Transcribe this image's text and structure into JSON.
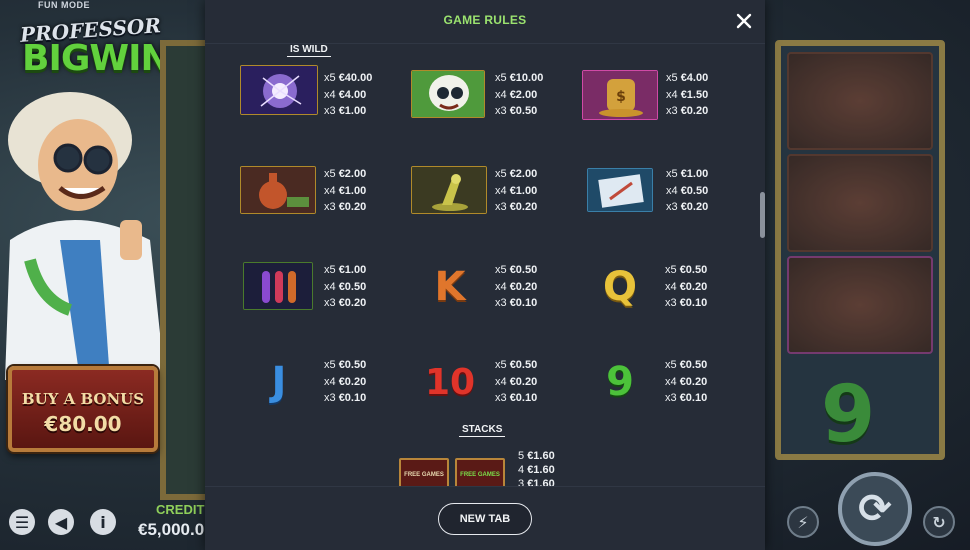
{
  "game": {
    "fun_mode": "FUN MODE",
    "logo_line1": "PROFESSOR",
    "logo_line2": "BIGWIN",
    "buy_bonus_label": "BUY A BONUS",
    "buy_bonus_price": "€80.00",
    "credit_label": "CREDIT",
    "credit_value": "€5,000.0",
    "reel_symbol": "9"
  },
  "modal": {
    "title": "GAME RULES",
    "close_icon": "close-icon",
    "is_wild_heading": "IS WILD",
    "stacks_heading": "STACKS",
    "new_tab_label": "NEW TAB",
    "paytable": [
      {
        "symbol": "plasma-ball",
        "pays": [
          {
            "count": "x5",
            "value": "€40.00"
          },
          {
            "count": "x4",
            "value": "€4.00"
          },
          {
            "count": "x3",
            "value": "€1.00"
          }
        ]
      },
      {
        "symbol": "professor-face",
        "pays": [
          {
            "count": "x5",
            "value": "€10.00"
          },
          {
            "count": "x4",
            "value": "€2.00"
          },
          {
            "count": "x3",
            "value": "€0.50"
          }
        ]
      },
      {
        "symbol": "money-jar",
        "pays": [
          {
            "count": "x5",
            "value": "€4.00"
          },
          {
            "count": "x4",
            "value": "€1.50"
          },
          {
            "count": "x3",
            "value": "€0.20"
          }
        ]
      },
      {
        "symbol": "flask",
        "pays": [
          {
            "count": "x5",
            "value": "€2.00"
          },
          {
            "count": "x4",
            "value": "€1.00"
          },
          {
            "count": "x3",
            "value": "€0.20"
          }
        ]
      },
      {
        "symbol": "microscope",
        "pays": [
          {
            "count": "x5",
            "value": "€2.00"
          },
          {
            "count": "x4",
            "value": "€1.00"
          },
          {
            "count": "x3",
            "value": "€0.20"
          }
        ]
      },
      {
        "symbol": "blueprint",
        "pays": [
          {
            "count": "x5",
            "value": "€1.00"
          },
          {
            "count": "x4",
            "value": "€0.50"
          },
          {
            "count": "x3",
            "value": "€0.20"
          }
        ]
      },
      {
        "symbol": "test-tubes",
        "pays": [
          {
            "count": "x5",
            "value": "€1.00"
          },
          {
            "count": "x4",
            "value": "€0.50"
          },
          {
            "count": "x3",
            "value": "€0.20"
          }
        ]
      },
      {
        "symbol": "K",
        "pays": [
          {
            "count": "x5",
            "value": "€0.50"
          },
          {
            "count": "x4",
            "value": "€0.20"
          },
          {
            "count": "x3",
            "value": "€0.10"
          }
        ]
      },
      {
        "symbol": "Q",
        "pays": [
          {
            "count": "x5",
            "value": "€0.50"
          },
          {
            "count": "x4",
            "value": "€0.20"
          },
          {
            "count": "x3",
            "value": "€0.10"
          }
        ]
      },
      {
        "symbol": "J",
        "pays": [
          {
            "count": "x5",
            "value": "€0.50"
          },
          {
            "count": "x4",
            "value": "€0.20"
          },
          {
            "count": "x3",
            "value": "€0.10"
          }
        ]
      },
      {
        "symbol": "10",
        "pays": [
          {
            "count": "x5",
            "value": "€0.50"
          },
          {
            "count": "x4",
            "value": "€0.20"
          },
          {
            "count": "x3",
            "value": "€0.10"
          }
        ]
      },
      {
        "symbol": "9",
        "pays": [
          {
            "count": "x5",
            "value": "€0.50"
          },
          {
            "count": "x4",
            "value": "€0.20"
          },
          {
            "count": "x3",
            "value": "€0.10"
          }
        ]
      }
    ],
    "stacks": {
      "pays": [
        {
          "count": "5",
          "value": "€1.60"
        },
        {
          "count": "4",
          "value": "€1.60"
        },
        {
          "count": "3",
          "value": "€1.60"
        }
      ],
      "free_games_label": "FREE GAMES"
    }
  },
  "colors": {
    "accent_green": "#9be36f",
    "modal_bg": "#262c37",
    "symbol_frame": "#b08a2a"
  }
}
